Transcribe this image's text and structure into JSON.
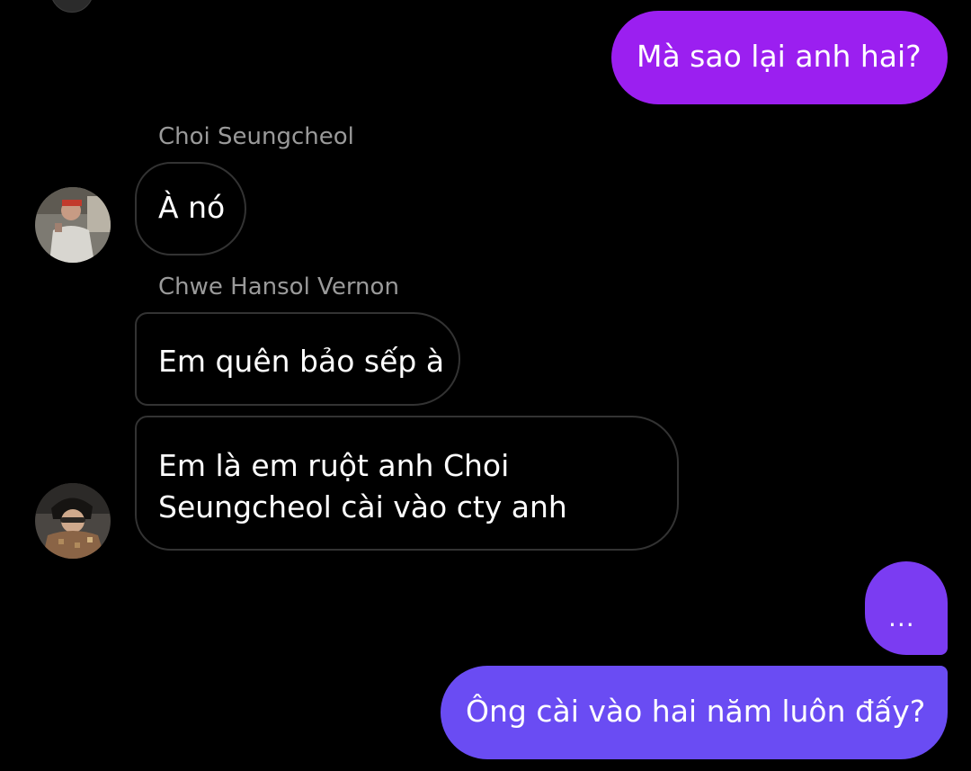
{
  "colors": {
    "background": "#000000",
    "outgoing_purple": "#9b1ff0",
    "outgoing_violet": "#7b3cf2",
    "outgoing_indigo": "#6a4cf3",
    "incoming_border": "#333333",
    "sender_name": "#9a9a9a"
  },
  "messages": [
    {
      "direction": "outgoing",
      "text": "Mà sao lại anh hai?"
    },
    {
      "direction": "incoming",
      "sender": "Choi Seungcheol",
      "text": "À nó"
    },
    {
      "direction": "incoming",
      "sender": "Chwe Hansol Vernon",
      "text": "Em quên bảo sếp à"
    },
    {
      "direction": "incoming",
      "lines": [
        "Em là em ruột anh Choi",
        "Seungcheol cài vào cty anh"
      ]
    },
    {
      "direction": "outgoing",
      "text": "..."
    },
    {
      "direction": "outgoing",
      "text": "Ông cài vào hai năm luôn đấy?"
    }
  ],
  "avatars": [
    {
      "icon": "avatar-seungcheol-photo"
    },
    {
      "icon": "avatar-vernon-photo"
    }
  ]
}
